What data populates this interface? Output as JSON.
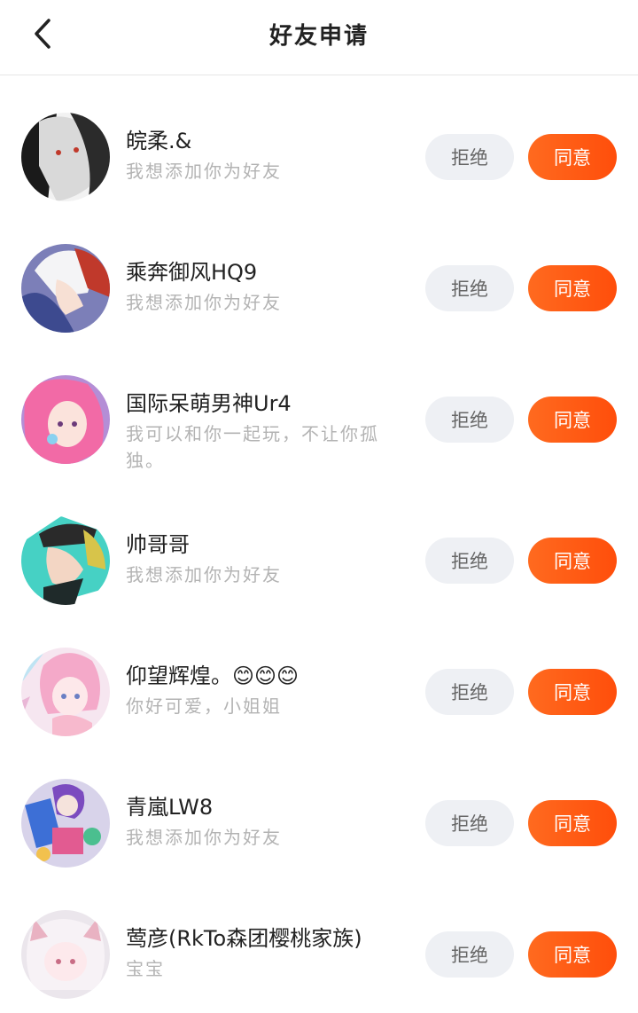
{
  "header": {
    "title": "好友申请"
  },
  "buttons": {
    "reject": "拒绝",
    "accept": "同意"
  },
  "requests": [
    {
      "name": "皖柔.&",
      "message": "我想添加你为好友"
    },
    {
      "name": "乘奔御风HQ9",
      "message": "我想添加你为好友"
    },
    {
      "name": "国际呆萌男神Ur4",
      "message": "我可以和你一起玩，不让你孤独。"
    },
    {
      "name": "帅哥哥",
      "message": "我想添加你为好友"
    },
    {
      "name": "仰望辉煌。😊😊😊",
      "message": "你好可爱，小姐姐"
    },
    {
      "name": "青嵐LW8",
      "message": "我想添加你为好友"
    },
    {
      "name": "莺彦(RkTo森团樱桃家族)",
      "message": "宝宝"
    }
  ]
}
